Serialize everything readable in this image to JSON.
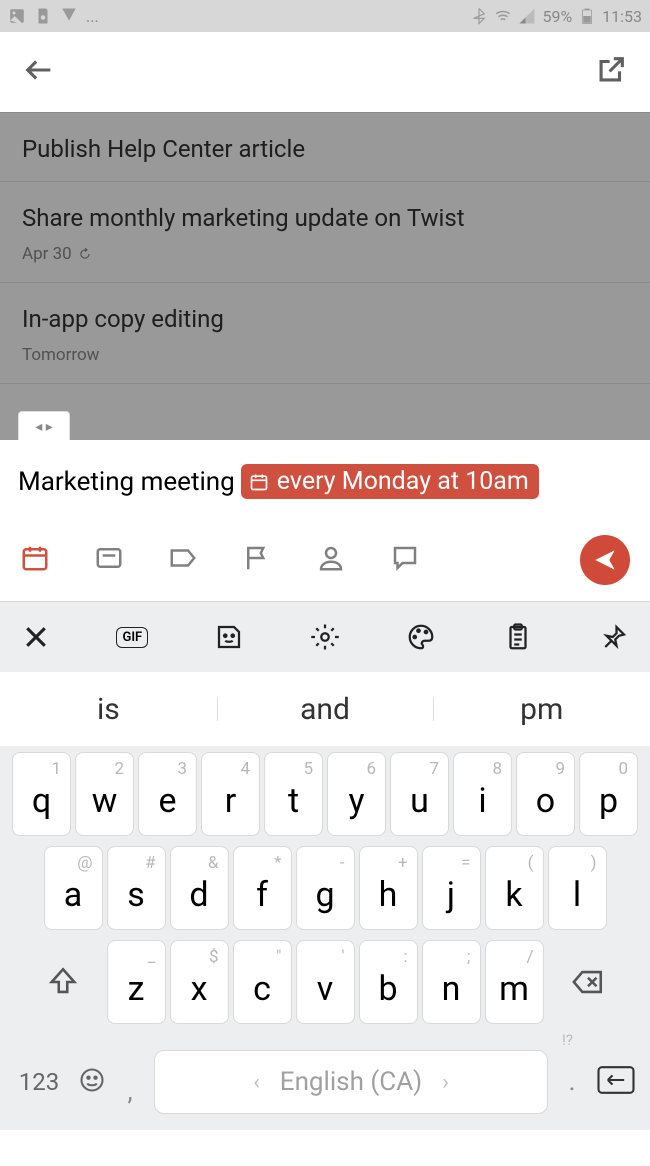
{
  "status": {
    "battery": "59%",
    "time": "11:53",
    "ellipsis": "..."
  },
  "tasks": [
    {
      "title": "Publish Help Center article",
      "meta": ""
    },
    {
      "title": "Share monthly marketing update on Twist",
      "meta": "Apr 30"
    },
    {
      "title": "In-app copy editing",
      "meta": "Tomorrow"
    }
  ],
  "cursorTab": "◂ ▸",
  "input": {
    "text": "Marketing meeting",
    "chip": "every Monday at 10am"
  },
  "kbd": {
    "gif": "GIF",
    "suggest": [
      "is",
      "and",
      "pm"
    ],
    "row1": [
      {
        "s": "1",
        "m": "q"
      },
      {
        "s": "2",
        "m": "w"
      },
      {
        "s": "3",
        "m": "e"
      },
      {
        "s": "4",
        "m": "r"
      },
      {
        "s": "5",
        "m": "t"
      },
      {
        "s": "6",
        "m": "y"
      },
      {
        "s": "7",
        "m": "u"
      },
      {
        "s": "8",
        "m": "i"
      },
      {
        "s": "9",
        "m": "o"
      },
      {
        "s": "0",
        "m": "p"
      }
    ],
    "row2": [
      {
        "s": "@",
        "m": "a"
      },
      {
        "s": "#",
        "m": "s"
      },
      {
        "s": "&",
        "m": "d"
      },
      {
        "s": "*",
        "m": "f"
      },
      {
        "s": "-",
        "m": "g"
      },
      {
        "s": "+",
        "m": "h"
      },
      {
        "s": "=",
        "m": "j"
      },
      {
        "s": "(",
        "m": "k"
      },
      {
        "s": ")",
        "m": "l"
      }
    ],
    "row3": [
      {
        "s": "_",
        "m": "z"
      },
      {
        "s": "$",
        "m": "x"
      },
      {
        "s": "\"",
        "m": "c"
      },
      {
        "s": "'",
        "m": "v"
      },
      {
        "s": ":",
        "m": "b"
      },
      {
        "s": ";",
        "m": "n"
      },
      {
        "s": "/",
        "m": "m"
      }
    ],
    "numLabel": "123",
    "space": "English (CA)",
    "comma": ",",
    "punct": "!?"
  }
}
